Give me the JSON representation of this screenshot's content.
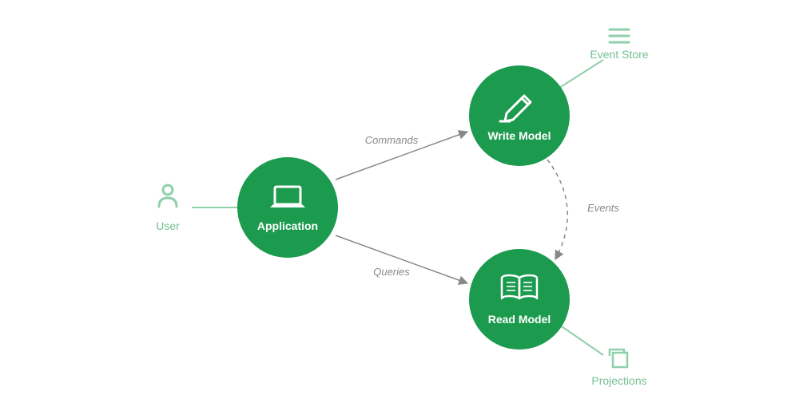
{
  "diagram": {
    "nodes": {
      "application": {
        "label": "Application"
      },
      "write_model": {
        "label": "Write Model"
      },
      "read_model": {
        "label": "Read Model"
      }
    },
    "externals": {
      "user": {
        "label": "User"
      },
      "event_store": {
        "label": "Event Store"
      },
      "projections": {
        "label": "Projections"
      }
    },
    "edges": {
      "commands": {
        "label": "Commands"
      },
      "queries": {
        "label": "Queries"
      },
      "events": {
        "label": "Events"
      }
    },
    "colors": {
      "brand": "#1c9a4e",
      "brand_light": "#8fd0aa",
      "arrow": "#888888"
    }
  }
}
